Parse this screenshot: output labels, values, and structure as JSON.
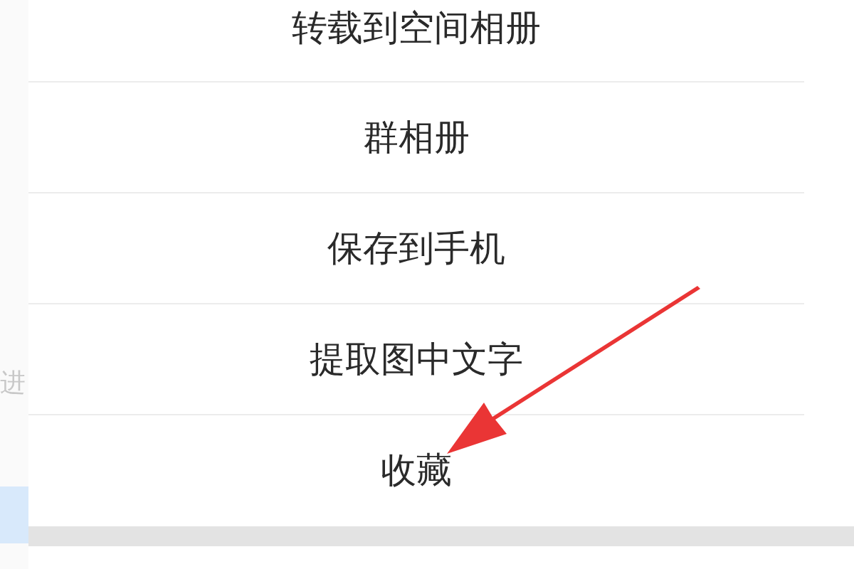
{
  "background_page": {
    "text": "进"
  },
  "menu": {
    "items": [
      {
        "label": "转载到空间相册"
      },
      {
        "label": "群相册"
      },
      {
        "label": "保存到手机"
      },
      {
        "label": "提取图中文字"
      },
      {
        "label": "收藏"
      }
    ]
  }
}
